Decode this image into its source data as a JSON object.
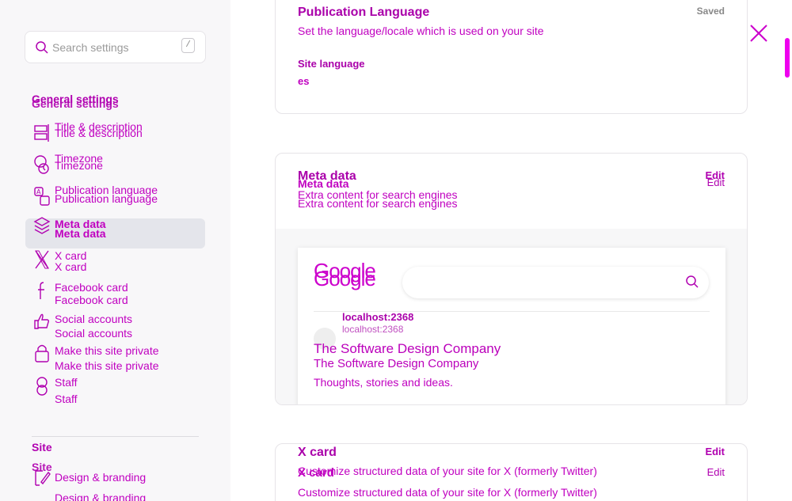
{
  "search": {
    "placeholder": "Search settings",
    "shortcut": "/"
  },
  "sidebar": {
    "general_title": "General settings",
    "general_items": [
      {
        "label": "Title & description",
        "icon": "title-icon"
      },
      {
        "label": "Timezone",
        "icon": "timezone-icon"
      },
      {
        "label": "Publication language",
        "icon": "language-icon"
      },
      {
        "label": "Meta data",
        "icon": "meta-data-icon",
        "active": true
      },
      {
        "label": "X card",
        "icon": "x-icon"
      },
      {
        "label": "Facebook card",
        "icon": "facebook-icon"
      },
      {
        "label": "Social accounts",
        "icon": "thumbs-up-icon"
      },
      {
        "label": "Make this site private",
        "icon": "lock-icon"
      },
      {
        "label": "Staff",
        "icon": "staff-icon"
      }
    ],
    "site_title": "Site",
    "site_items": [
      {
        "label": "Design & branding",
        "icon": "design-icon"
      }
    ]
  },
  "publication_language": {
    "title": "Publication Language",
    "status": "Saved",
    "description": "Set the language/locale which is used on your site",
    "field_label": "Site language",
    "field_value": "es"
  },
  "meta_data": {
    "title": "Meta data",
    "description": "Extra content for search engines",
    "edit": "Edit",
    "preview": {
      "logo": "Google",
      "url": "localhost:2368",
      "title": "The Software Design Company",
      "description": "Thoughts, stories and ideas."
    }
  },
  "x_card": {
    "title": "X card",
    "description": "Customize structured data of your site for X (formerly Twitter)",
    "edit": "Edit"
  },
  "colors": {
    "accent": "#cc00cc",
    "active_bg": "#e4e5eb",
    "sidebar_bg": "#f8f7f9"
  }
}
